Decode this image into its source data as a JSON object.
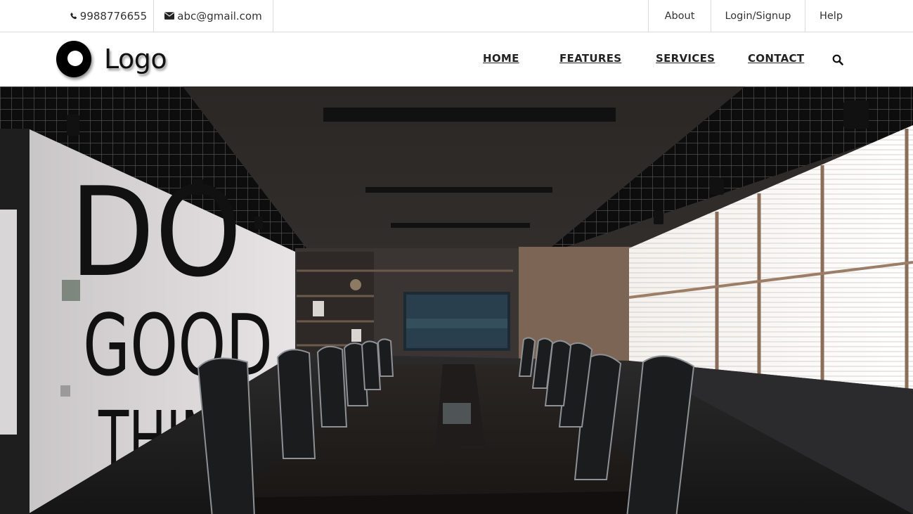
{
  "topbar": {
    "phone": {
      "icon": "phone-icon",
      "text": "9988776655"
    },
    "email": {
      "icon": "envelope-icon",
      "text": "abc@gmail.com"
    },
    "links": [
      "About",
      "Login/Signup",
      "Help"
    ]
  },
  "navbar": {
    "logo_text": "Logo",
    "links": [
      "HOME",
      "FEATURES",
      "SERVICES",
      "CONTACT"
    ],
    "search_icon": "search-icon"
  },
  "hero": {
    "wall_text": [
      "DO",
      "GOOD",
      "THINGS"
    ],
    "image_subject": "conference-room-photo"
  },
  "colors": {
    "text": "#333333",
    "nav_text": "#222222",
    "divider": "#dcdcdc",
    "hero_dark": "#1a1a1a"
  }
}
